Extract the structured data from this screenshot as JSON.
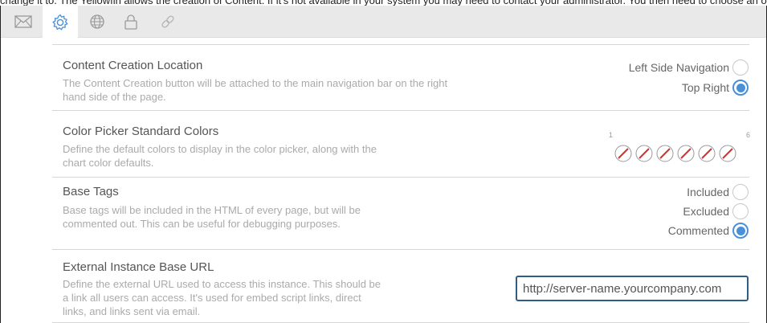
{
  "top_text": "change it to. The Yellowfin allows the creation of Content. If it's not available in your system you may need to contact your administrator. You then need to choose an option",
  "tabs": [
    {
      "icon": "envelope-icon",
      "active": false
    },
    {
      "icon": "gear-icon",
      "active": true
    },
    {
      "icon": "globe-icon",
      "active": false
    },
    {
      "icon": "lock-icon",
      "active": false
    },
    {
      "icon": "link-icon",
      "active": false
    }
  ],
  "settings": {
    "content_creation": {
      "title": "Content Creation Location",
      "description": "The Content Creation button will be attached to the main navigation bar on the right hand side of the page.",
      "options": [
        {
          "label": "Left Side Navigation",
          "checked": false
        },
        {
          "label": "Top Right",
          "checked": true
        }
      ]
    },
    "color_picker": {
      "title": "Color Picker Standard Colors",
      "description": "Define the default colors to display in the color picker, along with the chart color defaults.",
      "range_start": "1",
      "range_end": "6",
      "swatch_count": 6,
      "swatch_state": "empty",
      "slash_color": "#d9312b"
    },
    "base_tags": {
      "title": "Base Tags",
      "description": "Base tags will be included in the HTML of every page, but will be commented out. This can be useful for debugging purposes.",
      "options": [
        {
          "label": "Included",
          "checked": false
        },
        {
          "label": "Excluded",
          "checked": false
        },
        {
          "label": "Commented",
          "checked": true
        }
      ]
    },
    "external_url": {
      "title": "External Instance Base URL",
      "description": "Define the external URL used to access this instance. This should be a link all users can access. It's used for embed script links, direct links, and links sent via email.",
      "value": "http://server-name.yourcompany.com"
    }
  },
  "colors": {
    "accent": "#4a90d9",
    "active_icon": "#4a90d9",
    "inactive_icon": "#9a9a9a",
    "input_border": "#2f5d8a"
  }
}
